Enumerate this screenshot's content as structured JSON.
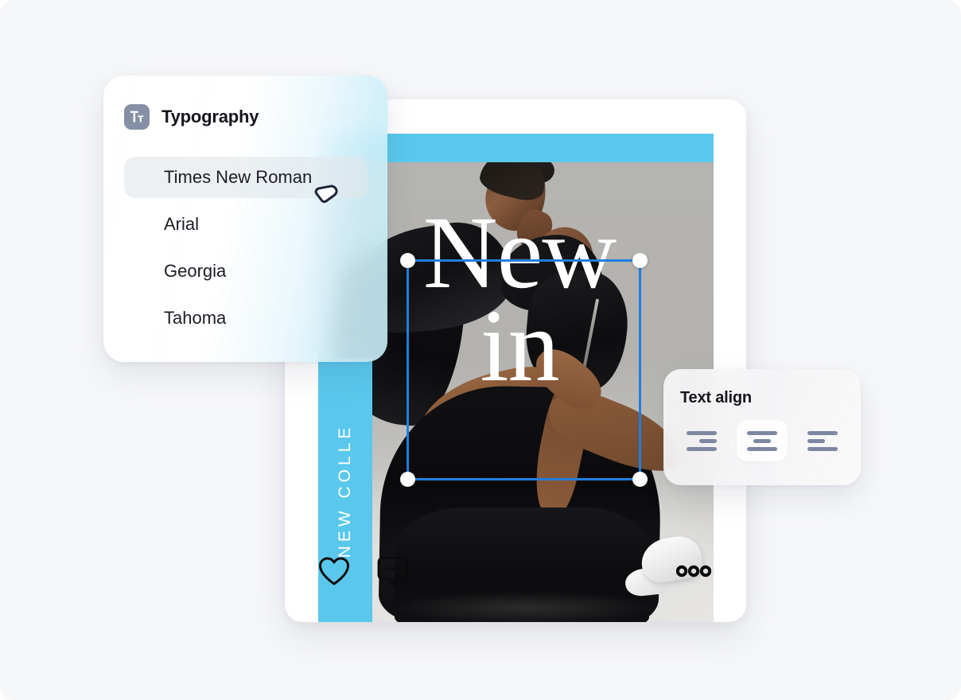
{
  "theme": {
    "page_background": "#f6f7f9",
    "brand_blue": "#5ac8ec",
    "selection_blue": "#1f7fe0",
    "icon_slate": "#8590a6",
    "text_dark": "#14161c"
  },
  "typography_panel": {
    "icon": "text-format-icon",
    "title": "Typography",
    "fonts": [
      {
        "label": "Times New Roman",
        "selected": true
      },
      {
        "label": "Arial",
        "selected": false
      },
      {
        "label": "Georgia",
        "selected": false
      },
      {
        "label": "Tahoma",
        "selected": false
      }
    ]
  },
  "text_align_panel": {
    "title": "Text align",
    "options": [
      {
        "name": "align-right",
        "active": false
      },
      {
        "name": "align-center",
        "active": true
      },
      {
        "name": "align-left",
        "active": false
      }
    ]
  },
  "post_card": {
    "banner_text": "NEW COLLE",
    "headline_line1": "New",
    "headline_line2": "in",
    "actions": {
      "like": "heart-icon",
      "comment": "comment-icon",
      "more": "more-options-icon"
    }
  },
  "cursor": {
    "name": "pointer-cursor"
  }
}
